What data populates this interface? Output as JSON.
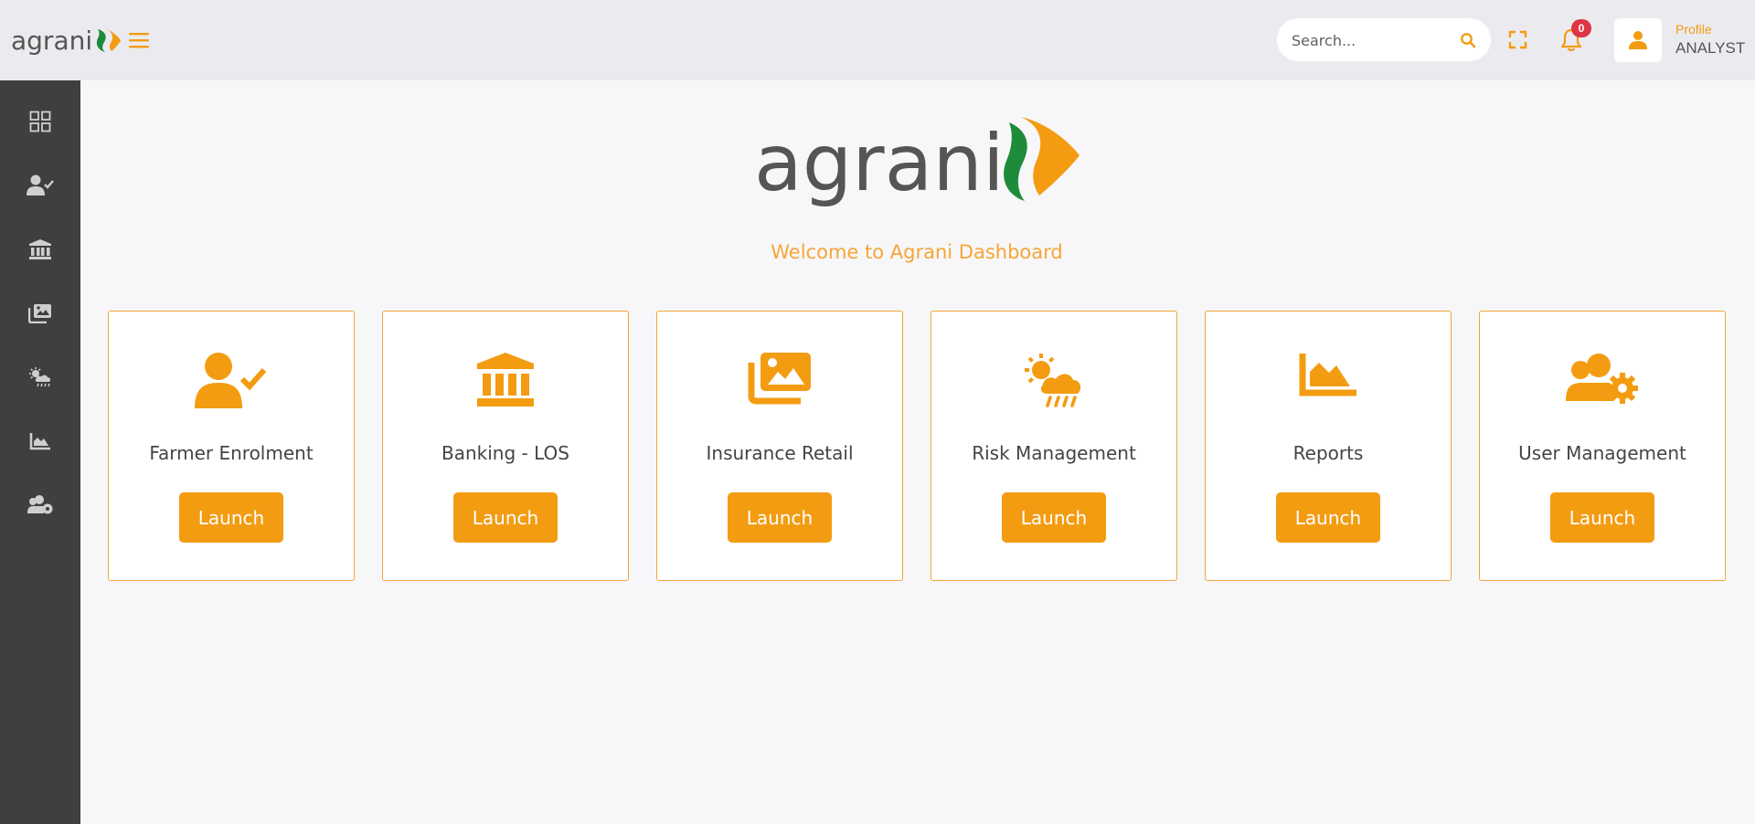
{
  "colors": {
    "accent": "#f39c12",
    "accent_light": "#f7a534",
    "sidebar_bg": "#3f3f3f",
    "header_bg": "#ebebef",
    "badge": "#dc3545",
    "logo_green": "#1e8b3a",
    "logo_orange": "#f39c12",
    "logo_gray": "#555555"
  },
  "header": {
    "brand_text": "agrani",
    "menu_icon": "hamburger-icon",
    "search": {
      "placeholder": "Search...",
      "value": "",
      "icon": "search-icon"
    },
    "fullscreen_icon": "fullscreen-icon",
    "notifications": {
      "icon": "bell-icon",
      "count": "0"
    },
    "profile": {
      "icon": "user-icon",
      "label": "Profile",
      "role": "ANALYST"
    }
  },
  "sidebar": {
    "items": [
      {
        "icon": "dashboard-grid-icon"
      },
      {
        "icon": "user-check-icon"
      },
      {
        "icon": "bank-icon"
      },
      {
        "icon": "images-icon"
      },
      {
        "icon": "weather-icon"
      },
      {
        "icon": "area-chart-icon"
      },
      {
        "icon": "users-cog-icon"
      }
    ]
  },
  "main": {
    "logo_text": "agrani",
    "welcome": "Welcome to Agrani Dashboard",
    "cards": [
      {
        "title": "Farmer Enrolment",
        "icon": "user-check-icon",
        "button": "Launch"
      },
      {
        "title": "Banking - LOS",
        "icon": "bank-icon",
        "button": "Launch"
      },
      {
        "title": "Insurance Retail",
        "icon": "images-icon",
        "button": "Launch"
      },
      {
        "title": "Risk Management",
        "icon": "weather-icon",
        "button": "Launch"
      },
      {
        "title": "Reports",
        "icon": "area-chart-icon",
        "button": "Launch"
      },
      {
        "title": "User Management",
        "icon": "users-cog-icon",
        "button": "Launch"
      }
    ]
  }
}
